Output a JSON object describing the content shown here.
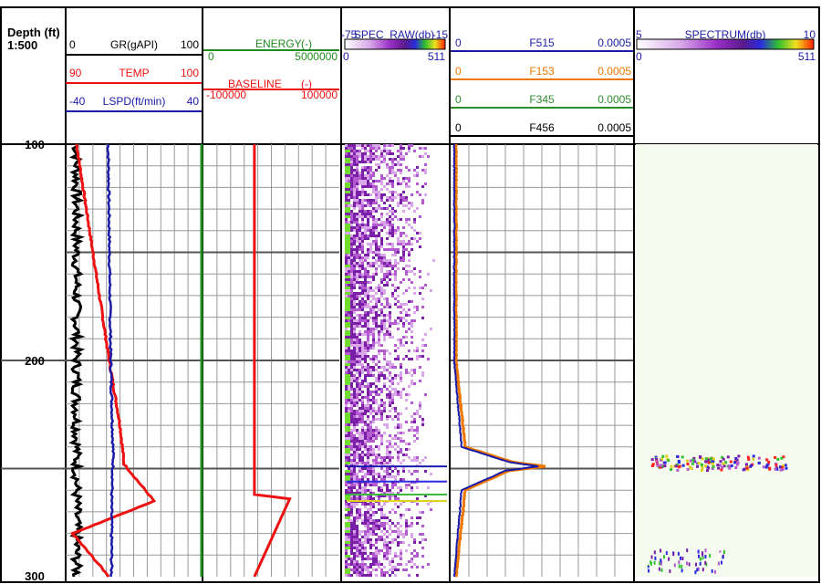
{
  "depth_header": {
    "label": "Depth (ft)",
    "scale": "1:500"
  },
  "colors": {
    "black": "#000000",
    "red": "#ee1111",
    "blue": "#1a1aa6",
    "green": "#1e8c1e",
    "orange": "#ee7700",
    "dark_green": "#2e8b2e",
    "grid": "#999999",
    "grid_major": "#555555"
  },
  "tracks": {
    "track1": [
      {
        "name": "GR(gAPI)",
        "min": "0",
        "max": "100",
        "color": "#000000"
      },
      {
        "name": "TEMP",
        "min": "90",
        "max": "100",
        "color": "#ee1111"
      },
      {
        "name": "LSPD(ft/min)",
        "min": "-40",
        "max": "40",
        "color": "#1a1aa6"
      }
    ],
    "track2": [
      {
        "name": "ENERGY",
        "unit": "(-)",
        "min": "0",
        "max": "5000000",
        "color": "#1e8c1e"
      },
      {
        "name": "BASELINE",
        "unit": "(-)",
        "min": "-100000",
        "max": "100000",
        "color": "#ee1111"
      }
    ],
    "track3": {
      "name": "SPEC_RAW(db)",
      "min": "-75",
      "max": "-15",
      "axis_min": "0",
      "axis_max": "511"
    },
    "track4": [
      {
        "name": "F515",
        "min": "0",
        "max": "0.0005",
        "color": "#1a1aa6"
      },
      {
        "name": "F153",
        "min": "0",
        "max": "0.0005",
        "color": "#ee7700"
      },
      {
        "name": "F345",
        "min": "0",
        "max": "0.0005",
        "color": "#2e8b2e"
      },
      {
        "name": "F456",
        "min": "0",
        "max": "0.0005",
        "color": "#000000"
      }
    ],
    "track5": {
      "name": "SPECTRUM(db)",
      "min": "5",
      "max": "10",
      "axis_min": "0",
      "axis_max": "511"
    }
  },
  "chart_data": {
    "type": "line",
    "depth_range": [
      100,
      300
    ],
    "depth_ticks": [
      "100",
      "200",
      "300"
    ],
    "series": [
      {
        "name": "TEMP",
        "depth": [
          100,
          150,
          200,
          230,
          248,
          265,
          280,
          300
        ],
        "values": [
          90.8,
          92.0,
          93.2,
          94.0,
          94.3,
          96.5,
          90.5,
          93.2
        ]
      },
      {
        "name": "LSPD(ft/min)",
        "depth": [
          100,
          200,
          245,
          265,
          300
        ],
        "values": [
          -15,
          -13.5,
          -12,
          -13,
          -13
        ]
      },
      {
        "name": "ENERGY",
        "depth": [
          100,
          300
        ],
        "values": [
          0,
          0
        ]
      },
      {
        "name": "BASELINE",
        "depth": [
          100,
          250,
          262,
          264,
          300
        ],
        "values": [
          -25000,
          -25000,
          -25000,
          27000,
          -25000
        ]
      },
      {
        "name": "F515",
        "depth": [
          100,
          200,
          240,
          247,
          249,
          251,
          260,
          300
        ],
        "values": [
          1e-05,
          1e-05,
          3e-05,
          0.00016,
          0.00024,
          0.00015,
          3e-05,
          1e-05
        ]
      },
      {
        "name": "F153",
        "depth": [
          100,
          200,
          240,
          247,
          249,
          251,
          260,
          300
        ],
        "values": [
          1.5e-05,
          1.5e-05,
          4e-05,
          0.00017,
          0.00026,
          0.00016,
          4e-05,
          1.5e-05
        ]
      },
      {
        "name": "GR(gAPI)",
        "depth": [
          100,
          300
        ],
        "values": [
          8,
          8
        ],
        "note": "noisy trace around ~5-15 gAPI"
      }
    ]
  }
}
